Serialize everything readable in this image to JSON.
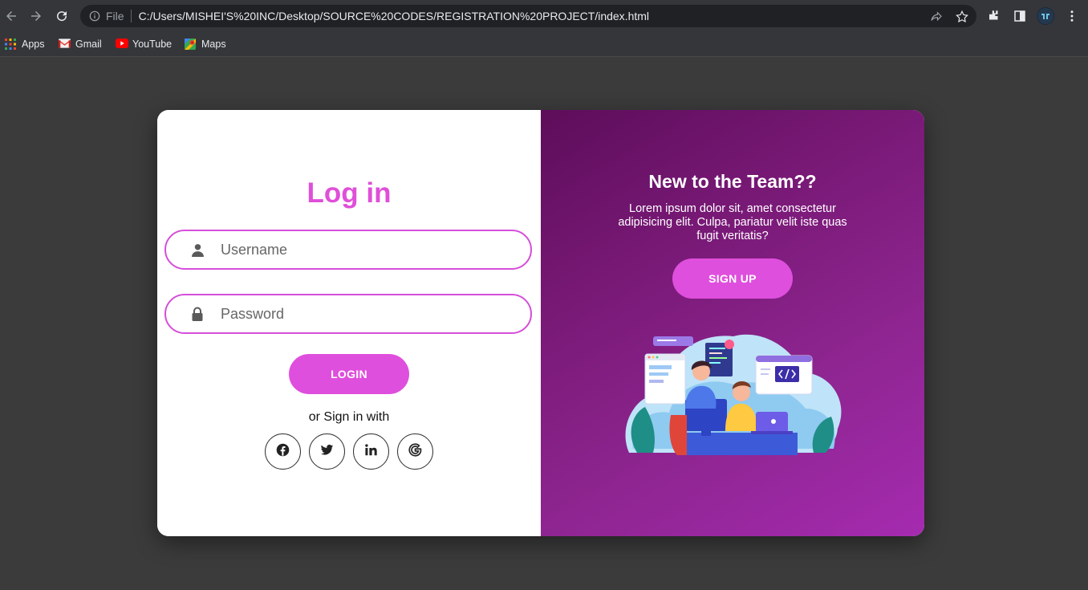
{
  "browser": {
    "scheme_label": "File",
    "url": "C:/Users/MISHEI'S%20INC/Desktop/SOURCE%20CODES/REGISTRATION%20PROJECT/index.html",
    "bookmarks": [
      {
        "label": "Apps",
        "icon": "apps-grid-icon"
      },
      {
        "label": "Gmail",
        "icon": "gmail-icon"
      },
      {
        "label": "YouTube",
        "icon": "youtube-icon"
      },
      {
        "label": "Maps",
        "icon": "maps-icon"
      }
    ]
  },
  "login": {
    "title": "Log in",
    "username_placeholder": "Username",
    "password_placeholder": "Password",
    "login_button": "LOGIN",
    "or_text": "or Sign in with",
    "socials": [
      "facebook-icon",
      "twitter-icon",
      "linkedin-icon",
      "google-icon"
    ]
  },
  "signup": {
    "title": "New to the Team??",
    "text": "Lorem ipsum dolor sit, amet consectetur adipisicing elit. Culpa, pariatur velit iste quas fugit veritatis?",
    "button": "SIGN UP"
  },
  "colors": {
    "accent": "#df4fdd",
    "panel_gradient_start": "#5d0d5a",
    "panel_gradient_end": "#a52bb0",
    "page_bg": "#3b3b3b"
  }
}
